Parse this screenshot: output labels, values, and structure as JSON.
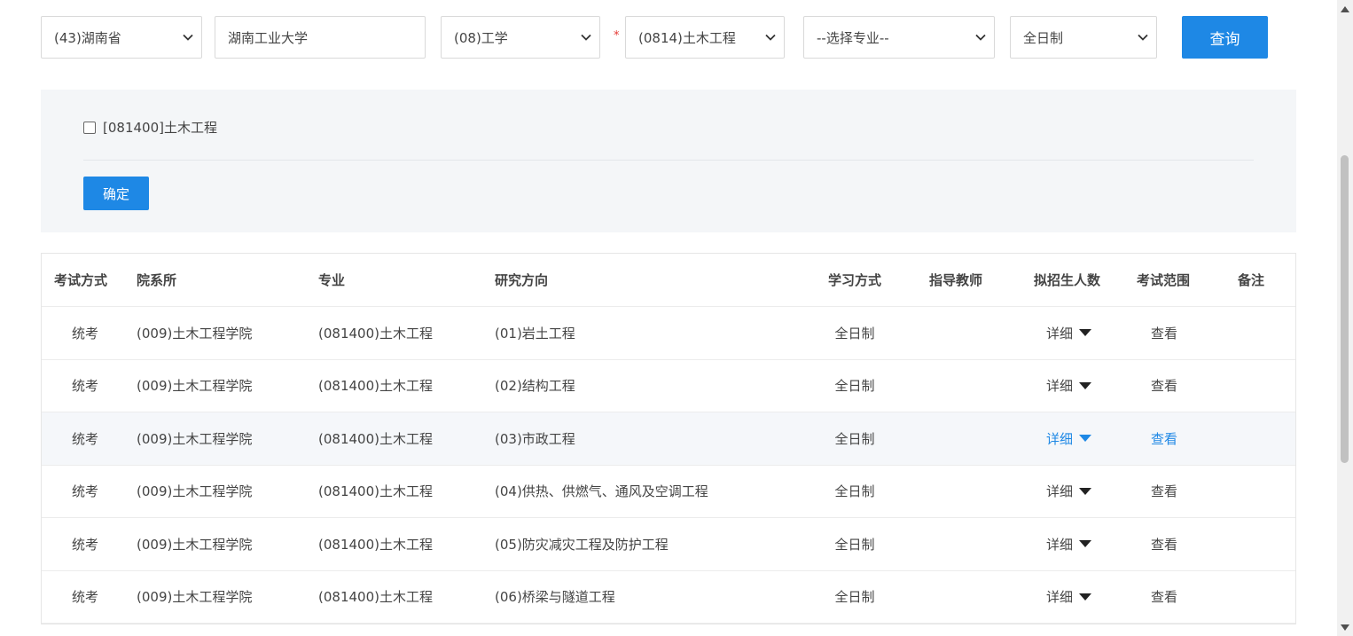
{
  "filters": {
    "province": "(43)湖南省",
    "school": "湖南工业大学",
    "category": "(08)工学",
    "required_mark": "*",
    "discipline": "(0814)土木工程",
    "major": "--选择专业--",
    "study_mode": "全日制",
    "query_label": "查询"
  },
  "panel": {
    "checkbox_label": "[081400]土木工程",
    "confirm_label": "确定"
  },
  "table": {
    "headers": [
      "考试方式",
      "院系所",
      "专业",
      "研究方向",
      "学习方式",
      "指导教师",
      "拟招生人数",
      "考试范围",
      "备注"
    ],
    "rows": [
      {
        "exam": "统考",
        "dept": "(009)土木工程学院",
        "major": "(081400)土木工程",
        "direction": "(01)岩土工程",
        "mode": "全日制",
        "advisor": "",
        "detail": "详细",
        "scope": "查看",
        "note": ""
      },
      {
        "exam": "统考",
        "dept": "(009)土木工程学院",
        "major": "(081400)土木工程",
        "direction": "(02)结构工程",
        "mode": "全日制",
        "advisor": "",
        "detail": "详细",
        "scope": "查看",
        "note": ""
      },
      {
        "exam": "统考",
        "dept": "(009)土木工程学院",
        "major": "(081400)土木工程",
        "direction": "(03)市政工程",
        "mode": "全日制",
        "advisor": "",
        "detail": "详细",
        "scope": "查看",
        "note": ""
      },
      {
        "exam": "统考",
        "dept": "(009)土木工程学院",
        "major": "(081400)土木工程",
        "direction": "(04)供热、供燃气、通风及空调工程",
        "mode": "全日制",
        "advisor": "",
        "detail": "详细",
        "scope": "查看",
        "note": ""
      },
      {
        "exam": "统考",
        "dept": "(009)土木工程学院",
        "major": "(081400)土木工程",
        "direction": "(05)防灾减灾工程及防护工程",
        "mode": "全日制",
        "advisor": "",
        "detail": "详细",
        "scope": "查看",
        "note": ""
      },
      {
        "exam": "统考",
        "dept": "(009)土木工程学院",
        "major": "(081400)土木工程",
        "direction": "(06)桥梁与隧道工程",
        "mode": "全日制",
        "advisor": "",
        "detail": "详细",
        "scope": "查看",
        "note": ""
      }
    ]
  },
  "colors": {
    "accent": "#1e88e5",
    "required": "#e53935"
  }
}
